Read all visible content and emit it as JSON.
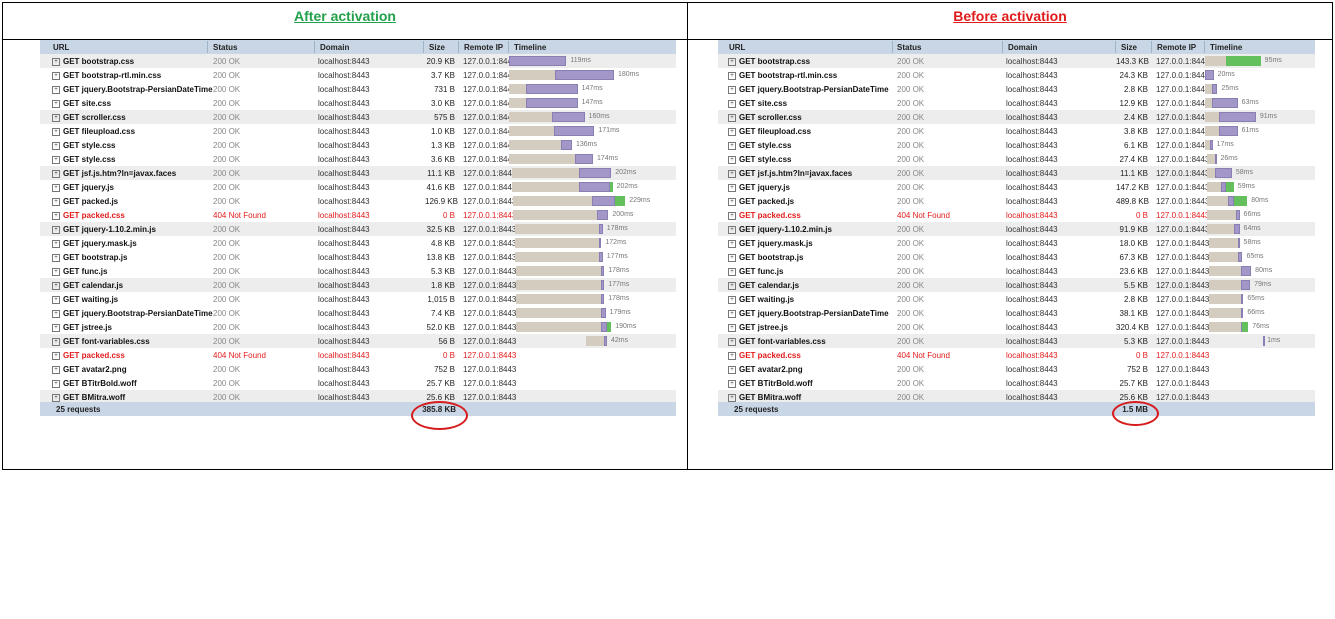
{
  "captions": {
    "left": "After activation",
    "right": "Before activation"
  },
  "columns": [
    "URL",
    "Status",
    "Domain",
    "Size",
    "Remote IP",
    "Timeline"
  ],
  "colors": {
    "after_caption": "#22a04b",
    "before_caption": "#e01b1b",
    "error_text": "#e41b1b",
    "header_bg": "#c9d6e5",
    "wait_bar": "#d3ccbf",
    "receive_bar": "#a397c8",
    "complete_bar": "#63c05d",
    "annotation_circle": "#d61d1d"
  },
  "after": {
    "rows": [
      {
        "url": "GET bootstrap.css",
        "status": "200 OK",
        "domain": "localhost:8443",
        "size": "20.9 KB",
        "ip": "127.0.0.1:8443",
        "time": "119ms",
        "start": 0,
        "wait": 0,
        "recv": 0.41,
        "done": 0,
        "err": false
      },
      {
        "url": "GET bootstrap-rtl.min.css",
        "status": "200 OK",
        "domain": "localhost:8443",
        "size": "3.7 KB",
        "ip": "127.0.0.1:8443",
        "time": "180ms",
        "start": 0,
        "wait": 0.33,
        "recv": 0.42,
        "done": 0,
        "err": false
      },
      {
        "url": "GET jquery.Bootstrap-PersianDateTime",
        "status": "200 OK",
        "domain": "localhost:8443",
        "size": "731 B",
        "ip": "127.0.0.1:8443",
        "time": "147ms",
        "start": 0,
        "wait": 0.12,
        "recv": 0.37,
        "done": 0,
        "err": false
      },
      {
        "url": "GET site.css",
        "status": "200 OK",
        "domain": "localhost:8443",
        "size": "3.0 KB",
        "ip": "127.0.0.1:8443",
        "time": "147ms",
        "start": 0,
        "wait": 0.12,
        "recv": 0.37,
        "done": 0,
        "err": false
      },
      {
        "url": "GET scroller.css",
        "status": "200 OK",
        "domain": "localhost:8443",
        "size": "575 B",
        "ip": "127.0.0.1:8443",
        "time": "160ms",
        "start": 0,
        "wait": 0.31,
        "recv": 0.23,
        "done": 0,
        "err": false
      },
      {
        "url": "GET fileupload.css",
        "status": "200 OK",
        "domain": "localhost:8443",
        "size": "1.0 KB",
        "ip": "127.0.0.1:8443",
        "time": "171ms",
        "start": 0,
        "wait": 0.32,
        "recv": 0.29,
        "done": 0,
        "err": false
      },
      {
        "url": "GET style.css",
        "status": "200 OK",
        "domain": "localhost:8443",
        "size": "1.3 KB",
        "ip": "127.0.0.1:8443",
        "time": "136ms",
        "start": 0,
        "wait": 0.37,
        "recv": 0.08,
        "done": 0,
        "err": false
      },
      {
        "url": "GET style.css",
        "status": "200 OK",
        "domain": "localhost:8443",
        "size": "3.6 KB",
        "ip": "127.0.0.1:8443",
        "time": "174ms",
        "start": 0,
        "wait": 0.47,
        "recv": 0.13,
        "done": 0,
        "err": false
      },
      {
        "url": "GET jsf.js.htm?ln=javax.faces",
        "status": "200 OK",
        "domain": "localhost:8443",
        "size": "11.1 KB",
        "ip": "127.0.0.1:8443",
        "time": "202ms",
        "start": 0.02,
        "wait": 0.48,
        "recv": 0.23,
        "done": 0,
        "err": false
      },
      {
        "url": "GET jquery.js",
        "status": "200 OK",
        "domain": "localhost:8443",
        "size": "41.6 KB",
        "ip": "127.0.0.1:8443",
        "time": "202ms",
        "start": 0.02,
        "wait": 0.48,
        "recv": 0.22,
        "done": 0.02,
        "err": false
      },
      {
        "url": "GET packed.js",
        "status": "200 OK",
        "domain": "localhost:8443",
        "size": "126.9 KB",
        "ip": "127.0.0.1:8443",
        "time": "229ms",
        "start": 0.03,
        "wait": 0.56,
        "recv": 0.17,
        "done": 0.07,
        "err": false
      },
      {
        "url": "GET packed.css",
        "status": "404 Not Found",
        "domain": "localhost:8443",
        "size": "0 B",
        "ip": "127.0.0.1:8443",
        "time": "200ms",
        "start": 0.03,
        "wait": 0.6,
        "recv": 0.08,
        "done": 0,
        "err": true
      },
      {
        "url": "GET jquery-1.10.2.min.js",
        "status": "200 OK",
        "domain": "localhost:8443",
        "size": "32.5 KB",
        "ip": "127.0.0.1:8443",
        "time": "178ms",
        "start": 0.04,
        "wait": 0.6,
        "recv": 0.03,
        "done": 0,
        "err": false
      },
      {
        "url": "GET jquery.mask.js",
        "status": "200 OK",
        "domain": "localhost:8443",
        "size": "4.8 KB",
        "ip": "127.0.0.1:8443",
        "time": "172ms",
        "start": 0.04,
        "wait": 0.6,
        "recv": 0.02,
        "done": 0,
        "err": false
      },
      {
        "url": "GET bootstrap.js",
        "status": "200 OK",
        "domain": "localhost:8443",
        "size": "13.8 KB",
        "ip": "127.0.0.1:8443",
        "time": "177ms",
        "start": 0.04,
        "wait": 0.6,
        "recv": 0.03,
        "done": 0,
        "err": false
      },
      {
        "url": "GET func.js",
        "status": "200 OK",
        "domain": "localhost:8443",
        "size": "5.3 KB",
        "ip": "127.0.0.1:8443",
        "time": "178ms",
        "start": 0.05,
        "wait": 0.61,
        "recv": 0.02,
        "done": 0,
        "err": false
      },
      {
        "url": "GET calendar.js",
        "status": "200 OK",
        "domain": "localhost:8443",
        "size": "1.8 KB",
        "ip": "127.0.0.1:8443",
        "time": "177ms",
        "start": 0.05,
        "wait": 0.61,
        "recv": 0.02,
        "done": 0,
        "err": false
      },
      {
        "url": "GET waiting.js",
        "status": "200 OK",
        "domain": "localhost:8443",
        "size": "1,015 B",
        "ip": "127.0.0.1:8443",
        "time": "178ms",
        "start": 0.05,
        "wait": 0.61,
        "recv": 0.02,
        "done": 0,
        "err": false
      },
      {
        "url": "GET jquery.Bootstrap-PersianDateTime",
        "status": "200 OK",
        "domain": "localhost:8443",
        "size": "7.4 KB",
        "ip": "127.0.0.1:8443",
        "time": "179ms",
        "start": 0.05,
        "wait": 0.61,
        "recv": 0.03,
        "done": 0,
        "err": false
      },
      {
        "url": "GET jstree.js",
        "status": "200 OK",
        "domain": "localhost:8443",
        "size": "52.0 KB",
        "ip": "127.0.0.1:8443",
        "time": "190ms",
        "start": 0.05,
        "wait": 0.61,
        "recv": 0.04,
        "done": 0.03,
        "err": false
      },
      {
        "url": "GET font-variables.css",
        "status": "200 OK",
        "domain": "localhost:8443",
        "size": "56 B",
        "ip": "127.0.0.1:8443",
        "time": "42ms",
        "start": 0.55,
        "wait": 0.13,
        "recv": 0.02,
        "done": 0,
        "err": false
      },
      {
        "url": "GET packed.css",
        "status": "404 Not Found",
        "domain": "localhost:8443",
        "size": "0 B",
        "ip": "127.0.0.1:8443",
        "time": "",
        "start": 0,
        "wait": 0,
        "recv": 0,
        "done": 0,
        "err": true
      },
      {
        "url": "GET avatar2.png",
        "status": "200 OK",
        "domain": "localhost:8443",
        "size": "752 B",
        "ip": "127.0.0.1:8443",
        "time": "",
        "start": 0,
        "wait": 0,
        "recv": 0,
        "done": 0,
        "err": false
      },
      {
        "url": "GET BTitrBold.woff",
        "status": "200 OK",
        "domain": "localhost:8443",
        "size": "25.7 KB",
        "ip": "127.0.0.1:8443",
        "time": "",
        "start": 0,
        "wait": 0,
        "recv": 0,
        "done": 0,
        "err": false
      },
      {
        "url": "GET BMitra.woff",
        "status": "200 OK",
        "domain": "localhost:8443",
        "size": "25.6 KB",
        "ip": "127.0.0.1:8443",
        "time": "",
        "start": 0,
        "wait": 0,
        "recv": 0,
        "done": 0,
        "err": false
      }
    ],
    "footer": {
      "requests": "25 requests",
      "total_size": "385.8 KB"
    }
  },
  "before": {
    "rows": [
      {
        "url": "GET bootstrap.css",
        "status": "200 OK",
        "domain": "localhost:8443",
        "size": "143.3 KB",
        "ip": "127.0.0.1:8443",
        "time": "95ms",
        "start": 0,
        "wait": 0.22,
        "recv": 0,
        "done": 0.36,
        "err": false
      },
      {
        "url": "GET bootstrap-rtl.min.css",
        "status": "200 OK",
        "domain": "localhost:8443",
        "size": "24.3 KB",
        "ip": "127.0.0.1:8443",
        "time": "20ms",
        "start": 0,
        "wait": 0,
        "recv": 0.09,
        "done": 0,
        "err": false
      },
      {
        "url": "GET jquery.Bootstrap-PersianDateTime",
        "status": "200 OK",
        "domain": "localhost:8443",
        "size": "2.8 KB",
        "ip": "127.0.0.1:8443",
        "time": "25ms",
        "start": 0,
        "wait": 0.07,
        "recv": 0.06,
        "done": 0,
        "err": false
      },
      {
        "url": "GET site.css",
        "status": "200 OK",
        "domain": "localhost:8443",
        "size": "12.9 KB",
        "ip": "127.0.0.1:8443",
        "time": "63ms",
        "start": 0,
        "wait": 0.07,
        "recv": 0.27,
        "done": 0,
        "err": false
      },
      {
        "url": "GET scroller.css",
        "status": "200 OK",
        "domain": "localhost:8443",
        "size": "2.4 KB",
        "ip": "127.0.0.1:8443",
        "time": "91ms",
        "start": 0,
        "wait": 0.15,
        "recv": 0.38,
        "done": 0,
        "err": false
      },
      {
        "url": "GET fileupload.css",
        "status": "200 OK",
        "domain": "localhost:8443",
        "size": "3.8 KB",
        "ip": "127.0.0.1:8443",
        "time": "61ms",
        "start": 0,
        "wait": 0.15,
        "recv": 0.19,
        "done": 0,
        "err": false
      },
      {
        "url": "GET style.css",
        "status": "200 OK",
        "domain": "localhost:8443",
        "size": "6.1 KB",
        "ip": "127.0.0.1:8443",
        "time": "17ms",
        "start": 0,
        "wait": 0.05,
        "recv": 0.03,
        "done": 0,
        "err": false
      },
      {
        "url": "GET style.css",
        "status": "200 OK",
        "domain": "localhost:8443",
        "size": "27.4 KB",
        "ip": "127.0.0.1:8443",
        "time": "26ms",
        "start": 0.02,
        "wait": 0.08,
        "recv": 0.02,
        "done": 0,
        "err": false
      },
      {
        "url": "GET jsf.js.htm?ln=javax.faces",
        "status": "200 OK",
        "domain": "localhost:8443",
        "size": "11.1 KB",
        "ip": "127.0.0.1:8443",
        "time": "58ms",
        "start": 0.02,
        "wait": 0.08,
        "recv": 0.18,
        "done": 0,
        "err": false
      },
      {
        "url": "GET jquery.js",
        "status": "200 OK",
        "domain": "localhost:8443",
        "size": "147.2 KB",
        "ip": "127.0.0.1:8443",
        "time": "59ms",
        "start": 0.02,
        "wait": 0.15,
        "recv": 0.05,
        "done": 0.08,
        "err": false
      },
      {
        "url": "GET packed.js",
        "status": "200 OK",
        "domain": "localhost:8443",
        "size": "489.8 KB",
        "ip": "127.0.0.1:8443",
        "time": "80ms",
        "start": 0.02,
        "wait": 0.22,
        "recv": 0.06,
        "done": 0.14,
        "err": false
      },
      {
        "url": "GET packed.css",
        "status": "404 Not Found",
        "domain": "localhost:8443",
        "size": "0 B",
        "ip": "127.0.0.1:8443",
        "time": "66ms",
        "start": 0.02,
        "wait": 0.3,
        "recv": 0.04,
        "done": 0,
        "err": true
      },
      {
        "url": "GET jquery-1.10.2.min.js",
        "status": "200 OK",
        "domain": "localhost:8443",
        "size": "91.9 KB",
        "ip": "127.0.0.1:8443",
        "time": "64ms",
        "start": 0.02,
        "wait": 0.28,
        "recv": 0.06,
        "done": 0,
        "err": false
      },
      {
        "url": "GET jquery.mask.js",
        "status": "200 OK",
        "domain": "localhost:8443",
        "size": "18.0 KB",
        "ip": "127.0.0.1:8443",
        "time": "58ms",
        "start": 0.04,
        "wait": 0.3,
        "recv": 0.02,
        "done": 0,
        "err": false
      },
      {
        "url": "GET bootstrap.js",
        "status": "200 OK",
        "domain": "localhost:8443",
        "size": "67.3 KB",
        "ip": "127.0.0.1:8443",
        "time": "65ms",
        "start": 0.04,
        "wait": 0.3,
        "recv": 0.05,
        "done": 0,
        "err": false
      },
      {
        "url": "GET func.js",
        "status": "200 OK",
        "domain": "localhost:8443",
        "size": "23.6 KB",
        "ip": "127.0.0.1:8443",
        "time": "80ms",
        "start": 0.04,
        "wait": 0.33,
        "recv": 0.11,
        "done": 0,
        "err": false
      },
      {
        "url": "GET calendar.js",
        "status": "200 OK",
        "domain": "localhost:8443",
        "size": "5.5 KB",
        "ip": "127.0.0.1:8443",
        "time": "79ms",
        "start": 0.04,
        "wait": 0.33,
        "recv": 0.1,
        "done": 0,
        "err": false
      },
      {
        "url": "GET waiting.js",
        "status": "200 OK",
        "domain": "localhost:8443",
        "size": "2.8 KB",
        "ip": "127.0.0.1:8443",
        "time": "65ms",
        "start": 0.04,
        "wait": 0.34,
        "recv": 0.02,
        "done": 0,
        "err": false
      },
      {
        "url": "GET jquery.Bootstrap-PersianDateTime",
        "status": "200 OK",
        "domain": "localhost:8443",
        "size": "38.1 KB",
        "ip": "127.0.0.1:8443",
        "time": "66ms",
        "start": 0.04,
        "wait": 0.34,
        "recv": 0.02,
        "done": 0,
        "err": false
      },
      {
        "url": "GET jstree.js",
        "status": "200 OK",
        "domain": "localhost:8443",
        "size": "320.4 KB",
        "ip": "127.0.0.1:8443",
        "time": "76ms",
        "start": 0.04,
        "wait": 0.33,
        "recv": 0.02,
        "done": 0.06,
        "err": false
      },
      {
        "url": "GET font-variables.css",
        "status": "200 OK",
        "domain": "localhost:8443",
        "size": "5.3 KB",
        "ip": "127.0.0.1:8443",
        "time": "1ms",
        "start": 0.6,
        "wait": 0,
        "recv": 0.005,
        "done": 0,
        "err": false
      },
      {
        "url": "GET packed.css",
        "status": "404 Not Found",
        "domain": "localhost:8443",
        "size": "0 B",
        "ip": "127.0.0.1:8443",
        "time": "",
        "start": 0,
        "wait": 0,
        "recv": 0,
        "done": 0,
        "err": true
      },
      {
        "url": "GET avatar2.png",
        "status": "200 OK",
        "domain": "localhost:8443",
        "size": "752 B",
        "ip": "127.0.0.1:8443",
        "time": "",
        "start": 0,
        "wait": 0,
        "recv": 0,
        "done": 0,
        "err": false
      },
      {
        "url": "GET BTitrBold.woff",
        "status": "200 OK",
        "domain": "localhost:8443",
        "size": "25.7 KB",
        "ip": "127.0.0.1:8443",
        "time": "",
        "start": 0,
        "wait": 0,
        "recv": 0,
        "done": 0,
        "err": false
      },
      {
        "url": "GET BMitra.woff",
        "status": "200 OK",
        "domain": "localhost:8443",
        "size": "25.6 KB",
        "ip": "127.0.0.1:8443",
        "time": "",
        "start": 0,
        "wait": 0,
        "recv": 0,
        "done": 0,
        "err": false
      }
    ],
    "footer": {
      "requests": "25 requests",
      "total_size": "1.5 MB"
    }
  }
}
